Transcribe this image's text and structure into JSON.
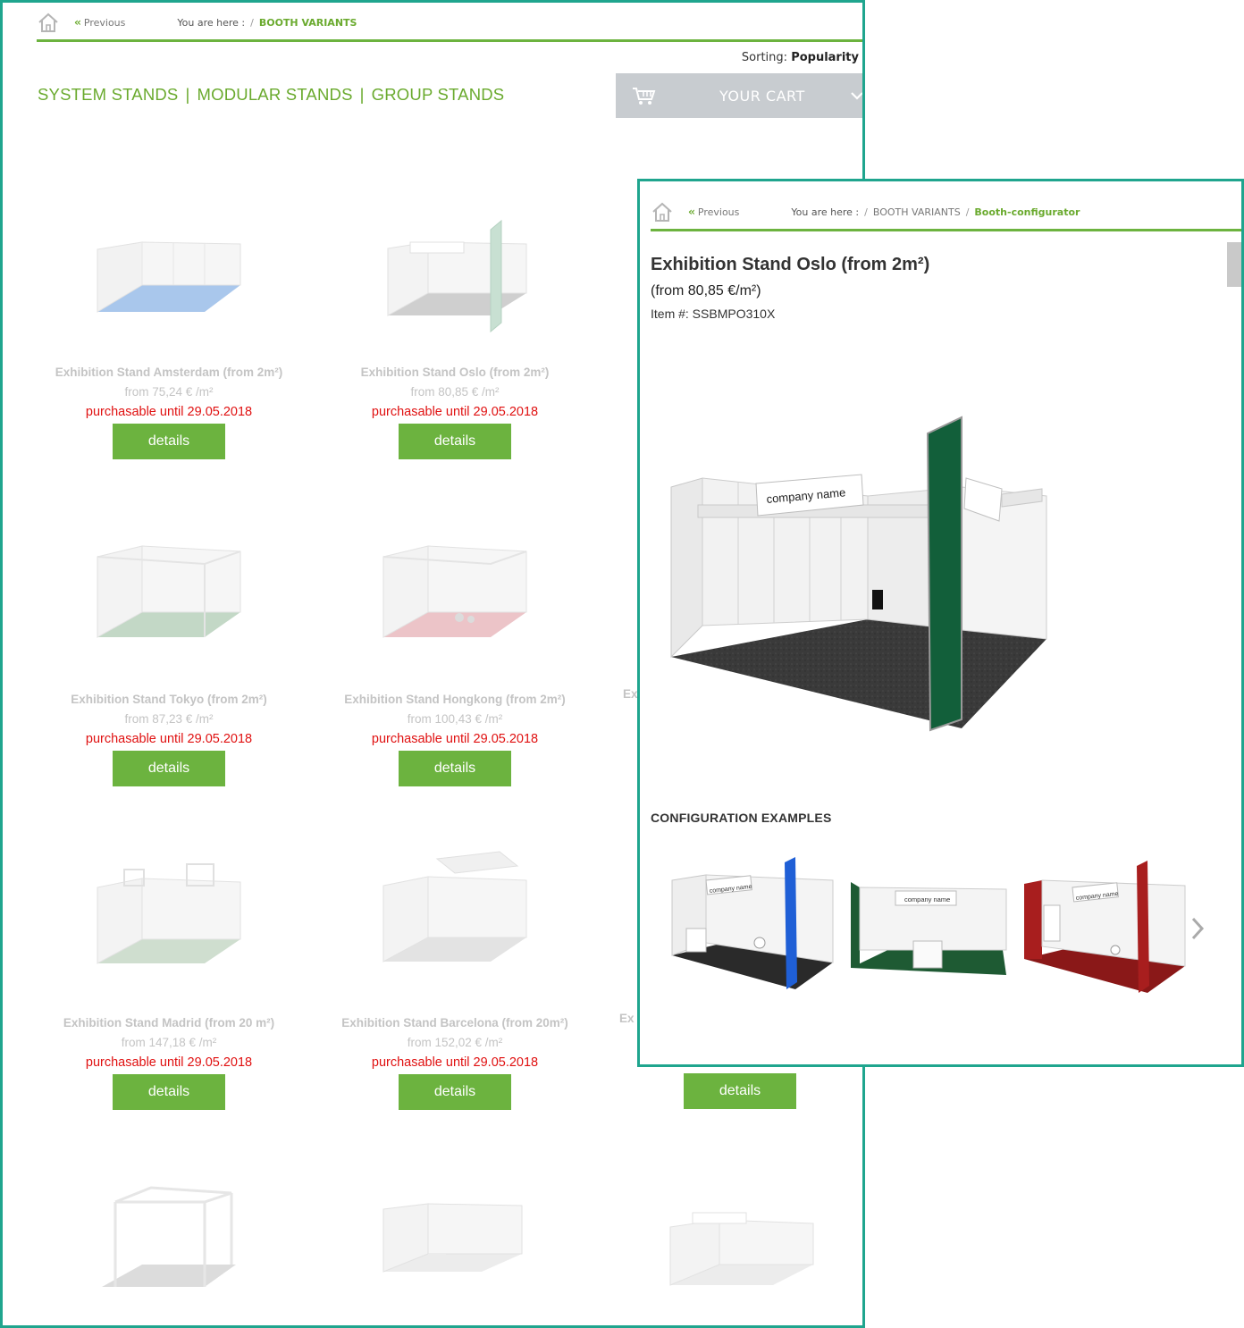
{
  "back": {
    "breadcrumb": {
      "previous": "Previous",
      "you_are_here": "You are here :",
      "separator": "/",
      "current": "BOOTH VARIANTS"
    },
    "sorting": {
      "label": "Sorting:",
      "value": "Popularity"
    },
    "categories": [
      "SYSTEM STANDS",
      "MODULAR STANDS",
      "GROUP STANDS"
    ],
    "category_separator": "|",
    "cart": {
      "label": "YOUR CART",
      "icon": "cart-icon"
    },
    "products": [
      {
        "title": "Exhibition Stand Amsterdam (from 2m²)",
        "price": "from 75,24 € /m²",
        "availability": "purchasable until 29.05.2018",
        "button": "details",
        "floor": "#a9c7ec"
      },
      {
        "title": "Exhibition Stand Oslo (from 2m²)",
        "price": "from 80,85 € /m²",
        "availability": "purchasable until 29.05.2018",
        "button": "details",
        "floor": "#cfcfcf"
      },
      {
        "title": "Exhibition Stand Tokyo (from 2m²)",
        "price": "from 87,23 € /m²",
        "availability": "purchasable until 29.05.2018",
        "button": "details",
        "floor": "#c3d8c6"
      },
      {
        "title": "Exhibition Stand Hongkong (from 2m²)",
        "price": "from 100,43 € /m²",
        "availability": "purchasable until 29.05.2018",
        "button": "details",
        "floor": "#ecc4c8"
      },
      {
        "title": "Exhibition Stand Madrid (from 20 m²)",
        "price": "from 147,18 € /m²",
        "availability": "purchasable until 29.05.2018",
        "button": "details",
        "floor": "#cfdecf"
      },
      {
        "title": "Exhibition Stand Barcelona (from 20m²)",
        "price": "from 152,02 € /m²",
        "availability": "purchasable until 29.05.2018",
        "button": "details",
        "floor": "#e3e3e3"
      }
    ],
    "partial_titles": [
      "Ex",
      "Ex",
      "Ex"
    ],
    "extra_button": "details"
  },
  "front": {
    "breadcrumb": {
      "previous": "Previous",
      "you_are_here": "You are here :",
      "separator": "/",
      "parent": "BOOTH VARIANTS",
      "current": "Booth-configurator"
    },
    "title": "Exhibition Stand Oslo (from 2m²)",
    "price": "(from 80,85 €/m²)",
    "item_number": "Item #: SSBMPO310X",
    "booth_sign": "company name",
    "config_heading": "CONFIGURATION EXAMPLES",
    "examples": [
      {
        "sign": "company name",
        "floor": "#2a2a2a",
        "accent": "#1f5fd6"
      },
      {
        "sign": "company name",
        "floor": "#1e5a33",
        "accent": "#1e5a33"
      },
      {
        "sign": "company name",
        "floor": "#8a1818",
        "accent": "#a81e1e"
      }
    ]
  },
  "colors": {
    "brand_green": "#6cb33f",
    "window_border": "#1fa58e",
    "alert_red": "#e01010",
    "cart_bg": "#c8ccd0"
  }
}
